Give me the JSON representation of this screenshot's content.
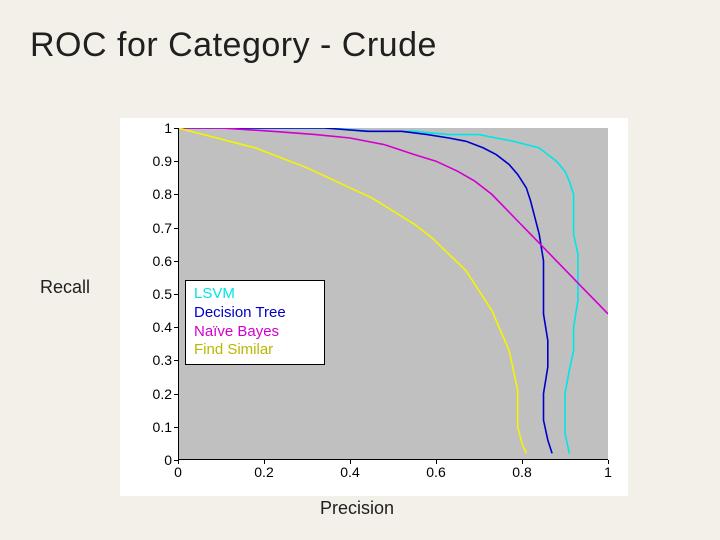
{
  "title": "ROC for Category - Crude",
  "ylabel": "Recall",
  "xlabel": "Precision",
  "legend": {
    "items": [
      {
        "label": "LSVM",
        "color": "#00e5e5"
      },
      {
        "label": "Decision Tree",
        "color": "#0000c8"
      },
      {
        "label": "Naïve Bayes",
        "color": "#d000d0"
      },
      {
        "label": "Find Similar",
        "color": "#f5f500"
      }
    ]
  },
  "chart_data": {
    "type": "line",
    "xlabel": "Precision",
    "ylabel": "Recall",
    "xlim": [
      0,
      1
    ],
    "ylim": [
      0,
      1
    ],
    "xticks": [
      0,
      0.2,
      0.4,
      0.6,
      0.8,
      1
    ],
    "yticks": [
      0,
      0.1,
      0.2,
      0.3,
      0.4,
      0.5,
      0.6,
      0.7,
      0.8,
      0.9,
      1
    ],
    "legend_position": "inside-left-middle",
    "series": [
      {
        "name": "LSVM",
        "color": "#00e5e5",
        "points": [
          [
            0.0,
            1.0
          ],
          [
            0.2,
            1.0
          ],
          [
            0.35,
            1.0
          ],
          [
            0.45,
            0.99
          ],
          [
            0.55,
            0.99
          ],
          [
            0.63,
            0.98
          ],
          [
            0.7,
            0.98
          ],
          [
            0.74,
            0.97
          ],
          [
            0.78,
            0.96
          ],
          [
            0.81,
            0.95
          ],
          [
            0.84,
            0.94
          ],
          [
            0.86,
            0.92
          ],
          [
            0.88,
            0.9
          ],
          [
            0.9,
            0.87
          ],
          [
            0.91,
            0.84
          ],
          [
            0.92,
            0.8
          ],
          [
            0.92,
            0.74
          ],
          [
            0.92,
            0.68
          ],
          [
            0.93,
            0.62
          ],
          [
            0.93,
            0.55
          ],
          [
            0.93,
            0.48
          ],
          [
            0.92,
            0.4
          ],
          [
            0.92,
            0.33
          ],
          [
            0.91,
            0.27
          ],
          [
            0.9,
            0.2
          ],
          [
            0.9,
            0.14
          ],
          [
            0.9,
            0.08
          ],
          [
            0.91,
            0.02
          ]
        ]
      },
      {
        "name": "Decision Tree",
        "color": "#0000c8",
        "points": [
          [
            0.0,
            1.0
          ],
          [
            0.1,
            1.0
          ],
          [
            0.22,
            1.0
          ],
          [
            0.34,
            1.0
          ],
          [
            0.44,
            0.99
          ],
          [
            0.52,
            0.99
          ],
          [
            0.58,
            0.98
          ],
          [
            0.63,
            0.97
          ],
          [
            0.67,
            0.96
          ],
          [
            0.71,
            0.94
          ],
          [
            0.74,
            0.92
          ],
          [
            0.77,
            0.89
          ],
          [
            0.79,
            0.86
          ],
          [
            0.81,
            0.82
          ],
          [
            0.82,
            0.78
          ],
          [
            0.83,
            0.73
          ],
          [
            0.84,
            0.68
          ],
          [
            0.85,
            0.6
          ],
          [
            0.85,
            0.52
          ],
          [
            0.85,
            0.44
          ],
          [
            0.86,
            0.36
          ],
          [
            0.86,
            0.28
          ],
          [
            0.85,
            0.2
          ],
          [
            0.85,
            0.12
          ],
          [
            0.86,
            0.06
          ],
          [
            0.87,
            0.02
          ]
        ]
      },
      {
        "name": "Naïve Bayes",
        "color": "#d000d0",
        "points": [
          [
            0.0,
            1.0
          ],
          [
            0.1,
            1.0
          ],
          [
            0.22,
            0.99
          ],
          [
            0.32,
            0.98
          ],
          [
            0.4,
            0.97
          ],
          [
            0.48,
            0.95
          ],
          [
            0.55,
            0.92
          ],
          [
            0.6,
            0.9
          ],
          [
            0.65,
            0.87
          ],
          [
            0.69,
            0.84
          ],
          [
            0.73,
            0.8
          ],
          [
            0.76,
            0.76
          ],
          [
            0.79,
            0.72
          ],
          [
            0.82,
            0.68
          ],
          [
            0.85,
            0.64
          ],
          [
            0.88,
            0.6
          ],
          [
            0.91,
            0.56
          ],
          [
            0.94,
            0.52
          ],
          [
            0.97,
            0.48
          ],
          [
            1.0,
            0.44
          ]
        ]
      },
      {
        "name": "Find Similar",
        "color": "#f5f500",
        "points": [
          [
            0.0,
            1.0
          ],
          [
            0.06,
            0.98
          ],
          [
            0.12,
            0.96
          ],
          [
            0.18,
            0.94
          ],
          [
            0.24,
            0.91
          ],
          [
            0.3,
            0.88
          ],
          [
            0.35,
            0.85
          ],
          [
            0.4,
            0.82
          ],
          [
            0.45,
            0.79
          ],
          [
            0.5,
            0.75
          ],
          [
            0.55,
            0.71
          ],
          [
            0.59,
            0.67
          ],
          [
            0.63,
            0.62
          ],
          [
            0.67,
            0.57
          ],
          [
            0.7,
            0.51
          ],
          [
            0.73,
            0.45
          ],
          [
            0.75,
            0.39
          ],
          [
            0.77,
            0.33
          ],
          [
            0.78,
            0.27
          ],
          [
            0.79,
            0.21
          ],
          [
            0.79,
            0.15
          ],
          [
            0.79,
            0.1
          ],
          [
            0.8,
            0.05
          ],
          [
            0.81,
            0.02
          ]
        ]
      }
    ]
  }
}
